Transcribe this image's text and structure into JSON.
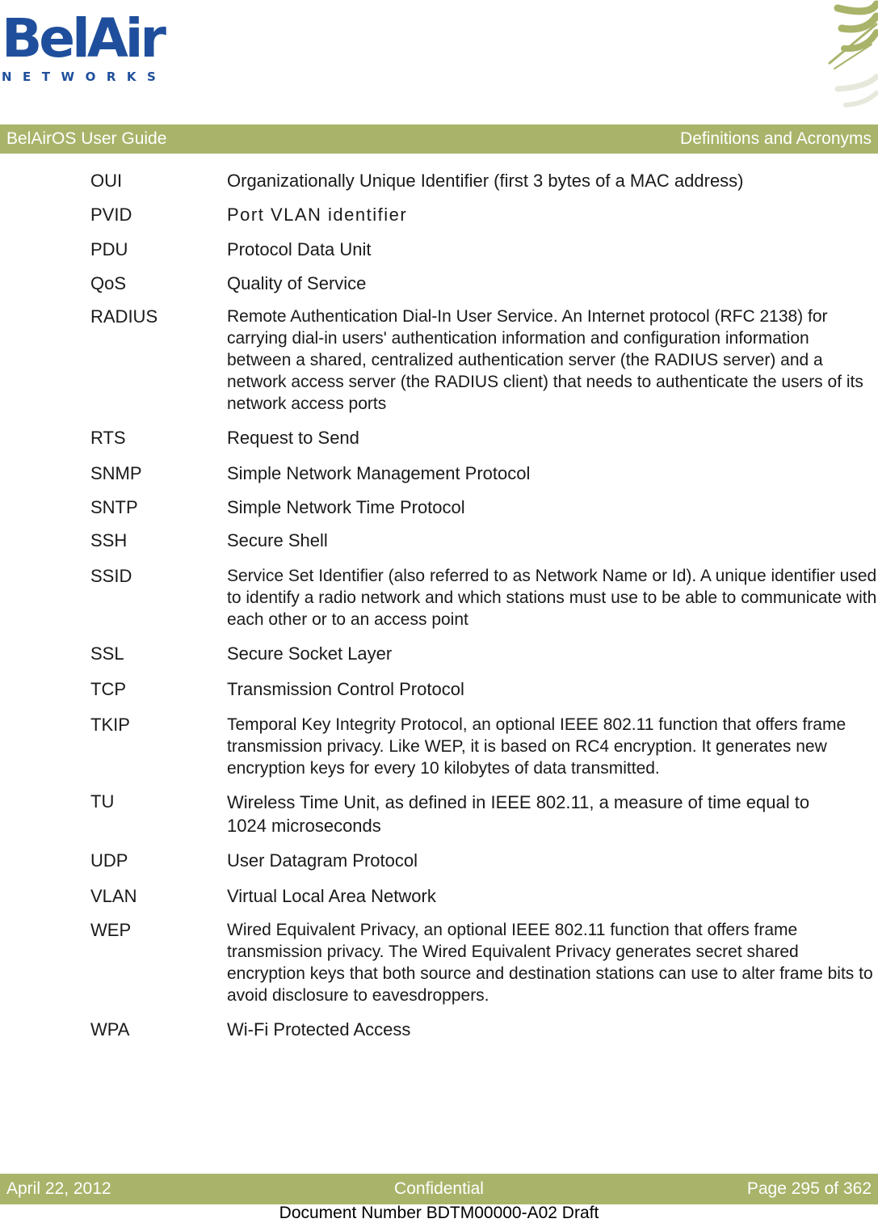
{
  "logo": {
    "brand": "BelAir",
    "subtitle": "NETWORKS"
  },
  "header": {
    "left": "BelAirOS User Guide",
    "right": "Definitions and Acronyms"
  },
  "entries": [
    {
      "term": "OUI",
      "definition": "Organizationally Unique Identifier (first 3 bytes of a MAC address)"
    },
    {
      "term": "PVID",
      "definition": "Port VLAN identifier"
    },
    {
      "term": "PDU",
      "definition": "Protocol Data Unit"
    },
    {
      "term": "QoS",
      "definition": "Quality of Service"
    },
    {
      "term": "RADIUS",
      "definition": "Remote Authentication Dial-In User Service. An Internet protocol (RFC 2138) for carrying dial-in users' authentication information and configuration information between a shared, centralized authentication server (the RADIUS server) and a network access server (the RADIUS client) that needs to authenticate the users of its network access ports"
    },
    {
      "term": "RTS",
      "definition": "Request to Send"
    },
    {
      "term": "SNMP",
      "definition": "Simple Network Management Protocol"
    },
    {
      "term": "SNTP",
      "definition": "Simple Network Time Protocol"
    },
    {
      "term": "SSH",
      "definition": "Secure Shell"
    },
    {
      "term": "SSID",
      "definition": "Service Set Identifier (also referred to as Network Name or Id). A unique identifier used to identify a radio network and which stations must use to be able to communicate with each other or to an access point"
    },
    {
      "term": "SSL",
      "definition": "Secure Socket Layer"
    },
    {
      "term": "TCP",
      "definition": "Transmission Control Protocol"
    },
    {
      "term": "TKIP",
      "definition": "Temporal Key Integrity Protocol, an optional IEEE 802.11 function that offers frame transmission privacy. Like WEP, it is based on RC4 encryption. It generates new encryption keys for every 10 kilobytes of data transmitted."
    },
    {
      "term": "TU",
      "definition": "Wireless Time Unit, as defined in IEEE 802.11, a measure of time equal to 1024 microseconds"
    },
    {
      "term": "UDP",
      "definition": "User Datagram Protocol"
    },
    {
      "term": "VLAN",
      "definition": "Virtual Local Area Network"
    },
    {
      "term": "WEP",
      "definition": "Wired Equivalent Privacy, an optional IEEE 802.11 function that offers frame transmission privacy. The Wired Equivalent Privacy generates secret shared encryption keys that both source and destination stations can use to alter frame bits to avoid disclosure to eavesdroppers."
    },
    {
      "term": "WPA",
      "definition": "Wi-Fi Protected Access"
    }
  ],
  "footer": {
    "date": "April 22, 2012",
    "classification": "Confidential",
    "page": "Page 295 of 362",
    "document_number": "Document Number BDTM00000-A02 Draft"
  },
  "colors": {
    "brand_blue": "#1f4f9c",
    "bar_green": "#a9b46a"
  }
}
